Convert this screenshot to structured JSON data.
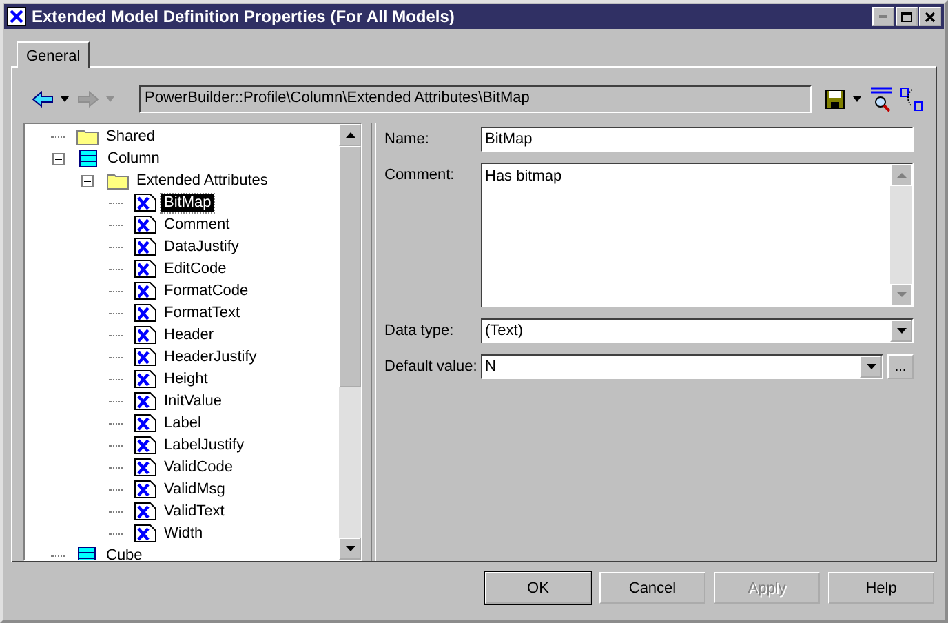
{
  "window": {
    "title": "Extended Model Definition Properties (For All Models)"
  },
  "tabs": [
    {
      "label": "General",
      "selected": true
    }
  ],
  "toolbar": {
    "path": "PowerBuilder::Profile\\Column\\Extended Attributes\\BitMap"
  },
  "tree": {
    "items": [
      {
        "kind": "folder",
        "label": "Shared",
        "selected": false
      },
      {
        "kind": "table",
        "label": "Column",
        "selected": false,
        "expanded": true,
        "children": [
          {
            "kind": "folder",
            "label": "Extended Attributes",
            "selected": false,
            "expanded": true,
            "children": [
              {
                "kind": "attribute",
                "label": "BitMap",
                "selected": true
              },
              {
                "kind": "attribute",
                "label": "Comment",
                "selected": false
              },
              {
                "kind": "attribute",
                "label": "DataJustify",
                "selected": false
              },
              {
                "kind": "attribute",
                "label": "EditCode",
                "selected": false
              },
              {
                "kind": "attribute",
                "label": "FormatCode",
                "selected": false
              },
              {
                "kind": "attribute",
                "label": "FormatText",
                "selected": false
              },
              {
                "kind": "attribute",
                "label": "Header",
                "selected": false
              },
              {
                "kind": "attribute",
                "label": "HeaderJustify",
                "selected": false
              },
              {
                "kind": "attribute",
                "label": "Height",
                "selected": false
              },
              {
                "kind": "attribute",
                "label": "InitValue",
                "selected": false
              },
              {
                "kind": "attribute",
                "label": "Label",
                "selected": false
              },
              {
                "kind": "attribute",
                "label": "LabelJustify",
                "selected": false
              },
              {
                "kind": "attribute",
                "label": "ValidCode",
                "selected": false
              },
              {
                "kind": "attribute",
                "label": "ValidMsg",
                "selected": false
              },
              {
                "kind": "attribute",
                "label": "ValidText",
                "selected": false
              },
              {
                "kind": "attribute",
                "label": "Width",
                "selected": false
              }
            ]
          }
        ]
      },
      {
        "kind": "table",
        "label": "Cube",
        "selected": false
      }
    ]
  },
  "form": {
    "fields": [
      {
        "kind": "text",
        "label": "Name:",
        "value": "BitMap"
      },
      {
        "kind": "textarea",
        "label": "Comment:",
        "value": "Has bitmap"
      },
      {
        "kind": "dropdown",
        "label": "Data type:",
        "value": "(Text)"
      },
      {
        "kind": "combo",
        "label": "Default value:",
        "value": "N",
        "button": "..."
      }
    ]
  },
  "buttons": [
    {
      "label": "OK",
      "default": true,
      "disabled": false
    },
    {
      "label": "Cancel",
      "default": false,
      "disabled": false
    },
    {
      "label": "Apply",
      "default": false,
      "disabled": true
    },
    {
      "label": "Help",
      "default": false,
      "disabled": false
    }
  ]
}
